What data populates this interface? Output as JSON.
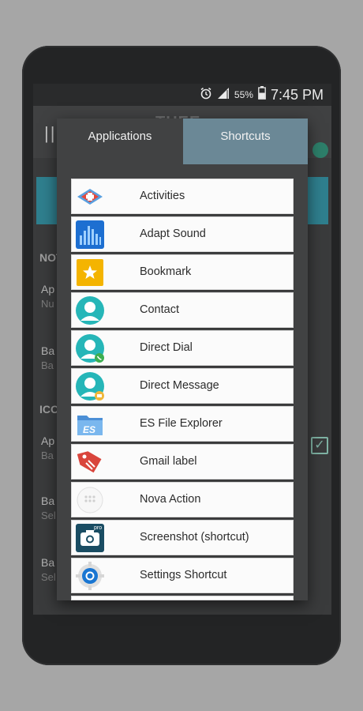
{
  "status_bar": {
    "battery_percent": "55%",
    "time": "7:45 PM"
  },
  "background_app": {
    "title": "THEE",
    "sections": [
      "NOT",
      "ICO"
    ],
    "rows": [
      {
        "title": "Ap",
        "sub": "Nu"
      },
      {
        "title": "Ba",
        "sub": "Ba"
      },
      {
        "title": "Ap",
        "sub": "Ba"
      },
      {
        "title": "Ba",
        "sub": "Sel"
      },
      {
        "title": "Ba",
        "sub": "Sel"
      }
    ],
    "accent": "#2f7f8e"
  },
  "dialog": {
    "tabs": [
      {
        "label": "Applications",
        "selected": false
      },
      {
        "label": "Shortcuts",
        "selected": true
      }
    ],
    "tab_selected_color": "#6b8896",
    "items": [
      {
        "label": "Activities",
        "icon": "activities-icon"
      },
      {
        "label": "Adapt Sound",
        "icon": "adapt-sound-icon"
      },
      {
        "label": "Bookmark",
        "icon": "bookmark-icon"
      },
      {
        "label": "Contact",
        "icon": "contact-icon"
      },
      {
        "label": "Direct Dial",
        "icon": "direct-dial-icon"
      },
      {
        "label": "Direct Message",
        "icon": "direct-message-icon"
      },
      {
        "label": "ES File Explorer",
        "icon": "es-file-explorer-icon"
      },
      {
        "label": "Gmail label",
        "icon": "gmail-label-icon"
      },
      {
        "label": "Nova Action",
        "icon": "nova-action-icon"
      },
      {
        "label": "Screenshot (shortcut)",
        "icon": "screenshot-icon"
      },
      {
        "label": "Settings Shortcut",
        "icon": "settings-shortcut-icon"
      }
    ]
  }
}
